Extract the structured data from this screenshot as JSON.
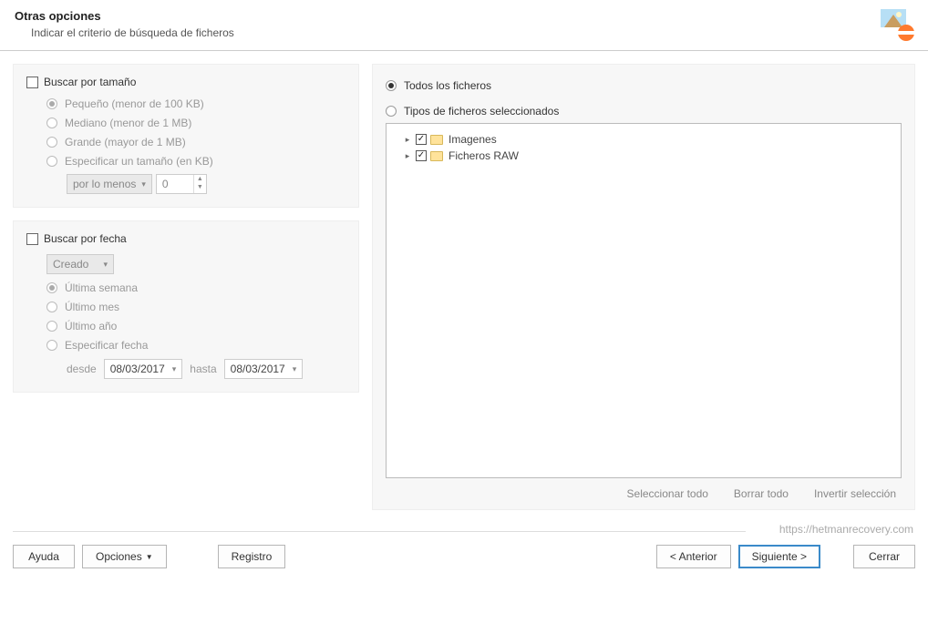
{
  "header": {
    "title": "Otras opciones",
    "subtitle": "Indicar el criterio de búsqueda de ficheros"
  },
  "size_panel": {
    "checkbox_label": "Buscar por tamaño",
    "opt_small": "Pequeño (menor de 100 KB)",
    "opt_medium": "Mediano (menor de 1 MB)",
    "opt_large": "Grande (mayor de 1 MB)",
    "opt_specify": "Especificar un tamaño (en KB)",
    "compare_label": "por lo  menos",
    "value": "0"
  },
  "date_panel": {
    "checkbox_label": "Buscar por fecha",
    "mode_label": "Creado",
    "opt_week": "Última semana",
    "opt_month": "Último mes",
    "opt_year": "Último año",
    "opt_specify": "Especificar fecha",
    "from_label": "desde",
    "to_label": "hasta",
    "from_value": "08/03/2017",
    "to_value": "08/03/2017"
  },
  "files_panel": {
    "radio_all": "Todos los ficheros",
    "radio_selected": "Tipos de ficheros seleccionados",
    "tree": [
      {
        "label": "Imagenes"
      },
      {
        "label": "Ficheros RAW"
      }
    ],
    "action_select_all": "Seleccionar todo",
    "action_clear_all": "Borrar todo",
    "action_invert": "Invertir selección"
  },
  "footer": {
    "url": "https://hetmanrecovery.com",
    "help": "Ayuda",
    "options": "Opciones",
    "register": "Registro",
    "back": "< Anterior",
    "next": "Siguiente >",
    "close": "Cerrar"
  }
}
